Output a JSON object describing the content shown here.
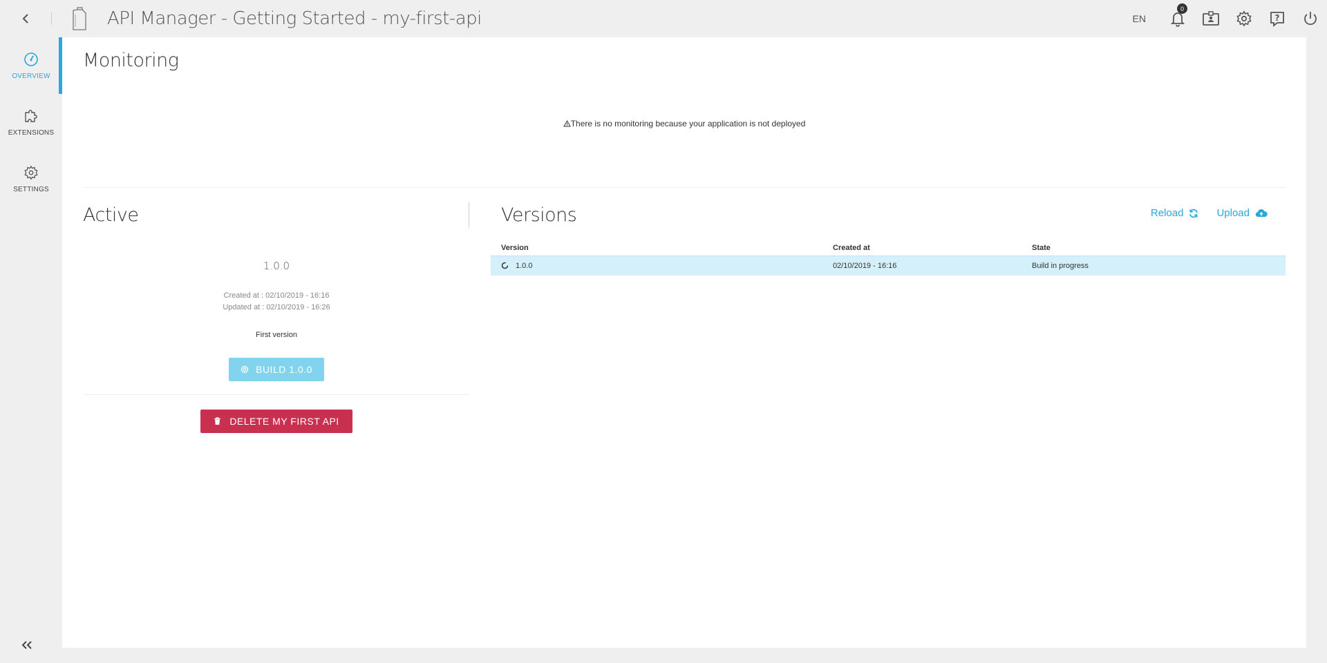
{
  "header": {
    "title": "API Manager - Getting Started - my-first-api",
    "lang": "EN",
    "notification_count": "0",
    "icons": [
      "back-icon",
      "app-logo-icon",
      "bell-icon",
      "id-card-icon",
      "gear-icon",
      "help-icon",
      "power-icon"
    ]
  },
  "sidebar": {
    "items": [
      {
        "label": "OVERVIEW",
        "icon": "dashboard-icon",
        "active": true
      },
      {
        "label": "EXTENSIONS",
        "icon": "puzzle-icon",
        "active": false
      },
      {
        "label": "SETTINGS",
        "icon": "gear-icon",
        "active": false
      }
    ],
    "collapse_icon": "double-chevron-left-icon"
  },
  "monitoring": {
    "title": "Monitoring",
    "message": "There is no monitoring because your application is not deployed"
  },
  "active": {
    "title": "Active",
    "version": "1.0.0",
    "created": "Created at  : 02/10/2019 - 16:16",
    "updated": "Updated at : 02/10/2019 - 16:26",
    "description": "First version",
    "build_label": "BUILD 1.0.0",
    "delete_label": "DELETE MY FIRST API"
  },
  "versions": {
    "title": "Versions",
    "reload_label": "Reload",
    "upload_label": "Upload",
    "columns": [
      "Version",
      "Created at",
      "State"
    ],
    "rows": [
      {
        "version": "1.0.0",
        "created": "02/10/2019 - 16:16",
        "state": "Build in progress"
      }
    ]
  },
  "colors": {
    "accent": "#29a8d9",
    "build_button": "#81d3ee",
    "delete_button": "#c9304f",
    "row_highlight": "#d4f0fa"
  }
}
